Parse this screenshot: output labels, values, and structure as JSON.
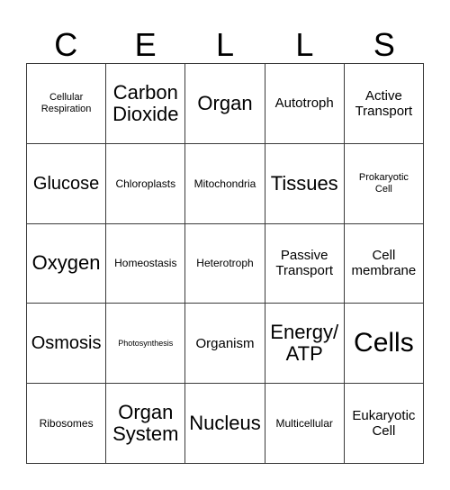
{
  "card": {
    "header_letters": [
      "C",
      "E",
      "L",
      "L",
      "S"
    ],
    "columns": 5,
    "rows": 5,
    "border_color": "#3a3a3a",
    "text_color": "#000000",
    "background_color": "#ffffff",
    "cells": [
      [
        {
          "text": "Cellular\nRespiration",
          "size": "xs"
        },
        {
          "text": "Carbon\nDioxide",
          "size": "xl"
        },
        {
          "text": "Organ",
          "size": "xl"
        },
        {
          "text": "Autotroph",
          "size": "md"
        },
        {
          "text": "Active\nTransport",
          "size": "md"
        }
      ],
      [
        {
          "text": "Glucose",
          "size": "lg"
        },
        {
          "text": "Chloroplasts",
          "size": "sm"
        },
        {
          "text": "Mitochondria",
          "size": "sm"
        },
        {
          "text": "Tissues",
          "size": "xl"
        },
        {
          "text": "Prokaryotic\nCell",
          "size": "xs"
        }
      ],
      [
        {
          "text": "Oxygen",
          "size": "xl"
        },
        {
          "text": "Homeostasis",
          "size": "sm"
        },
        {
          "text": "Heterotroph",
          "size": "sm"
        },
        {
          "text": "Passive\nTransport",
          "size": "md"
        },
        {
          "text": "Cell\nmembrane",
          "size": "md"
        }
      ],
      [
        {
          "text": "Osmosis",
          "size": "lg"
        },
        {
          "text": "Photosynthesis",
          "size": "xxs"
        },
        {
          "text": "Organism",
          "size": "md"
        },
        {
          "text": "Energy/\nATP",
          "size": "xl"
        },
        {
          "text": "Cells",
          "size": "xxl"
        }
      ],
      [
        {
          "text": "Ribosomes",
          "size": "sm"
        },
        {
          "text": "Organ\nSystem",
          "size": "xl"
        },
        {
          "text": "Nucleus",
          "size": "xl"
        },
        {
          "text": "Multicellular",
          "size": "sm"
        },
        {
          "text": "Eukaryotic\nCell",
          "size": "md"
        }
      ]
    ]
  }
}
